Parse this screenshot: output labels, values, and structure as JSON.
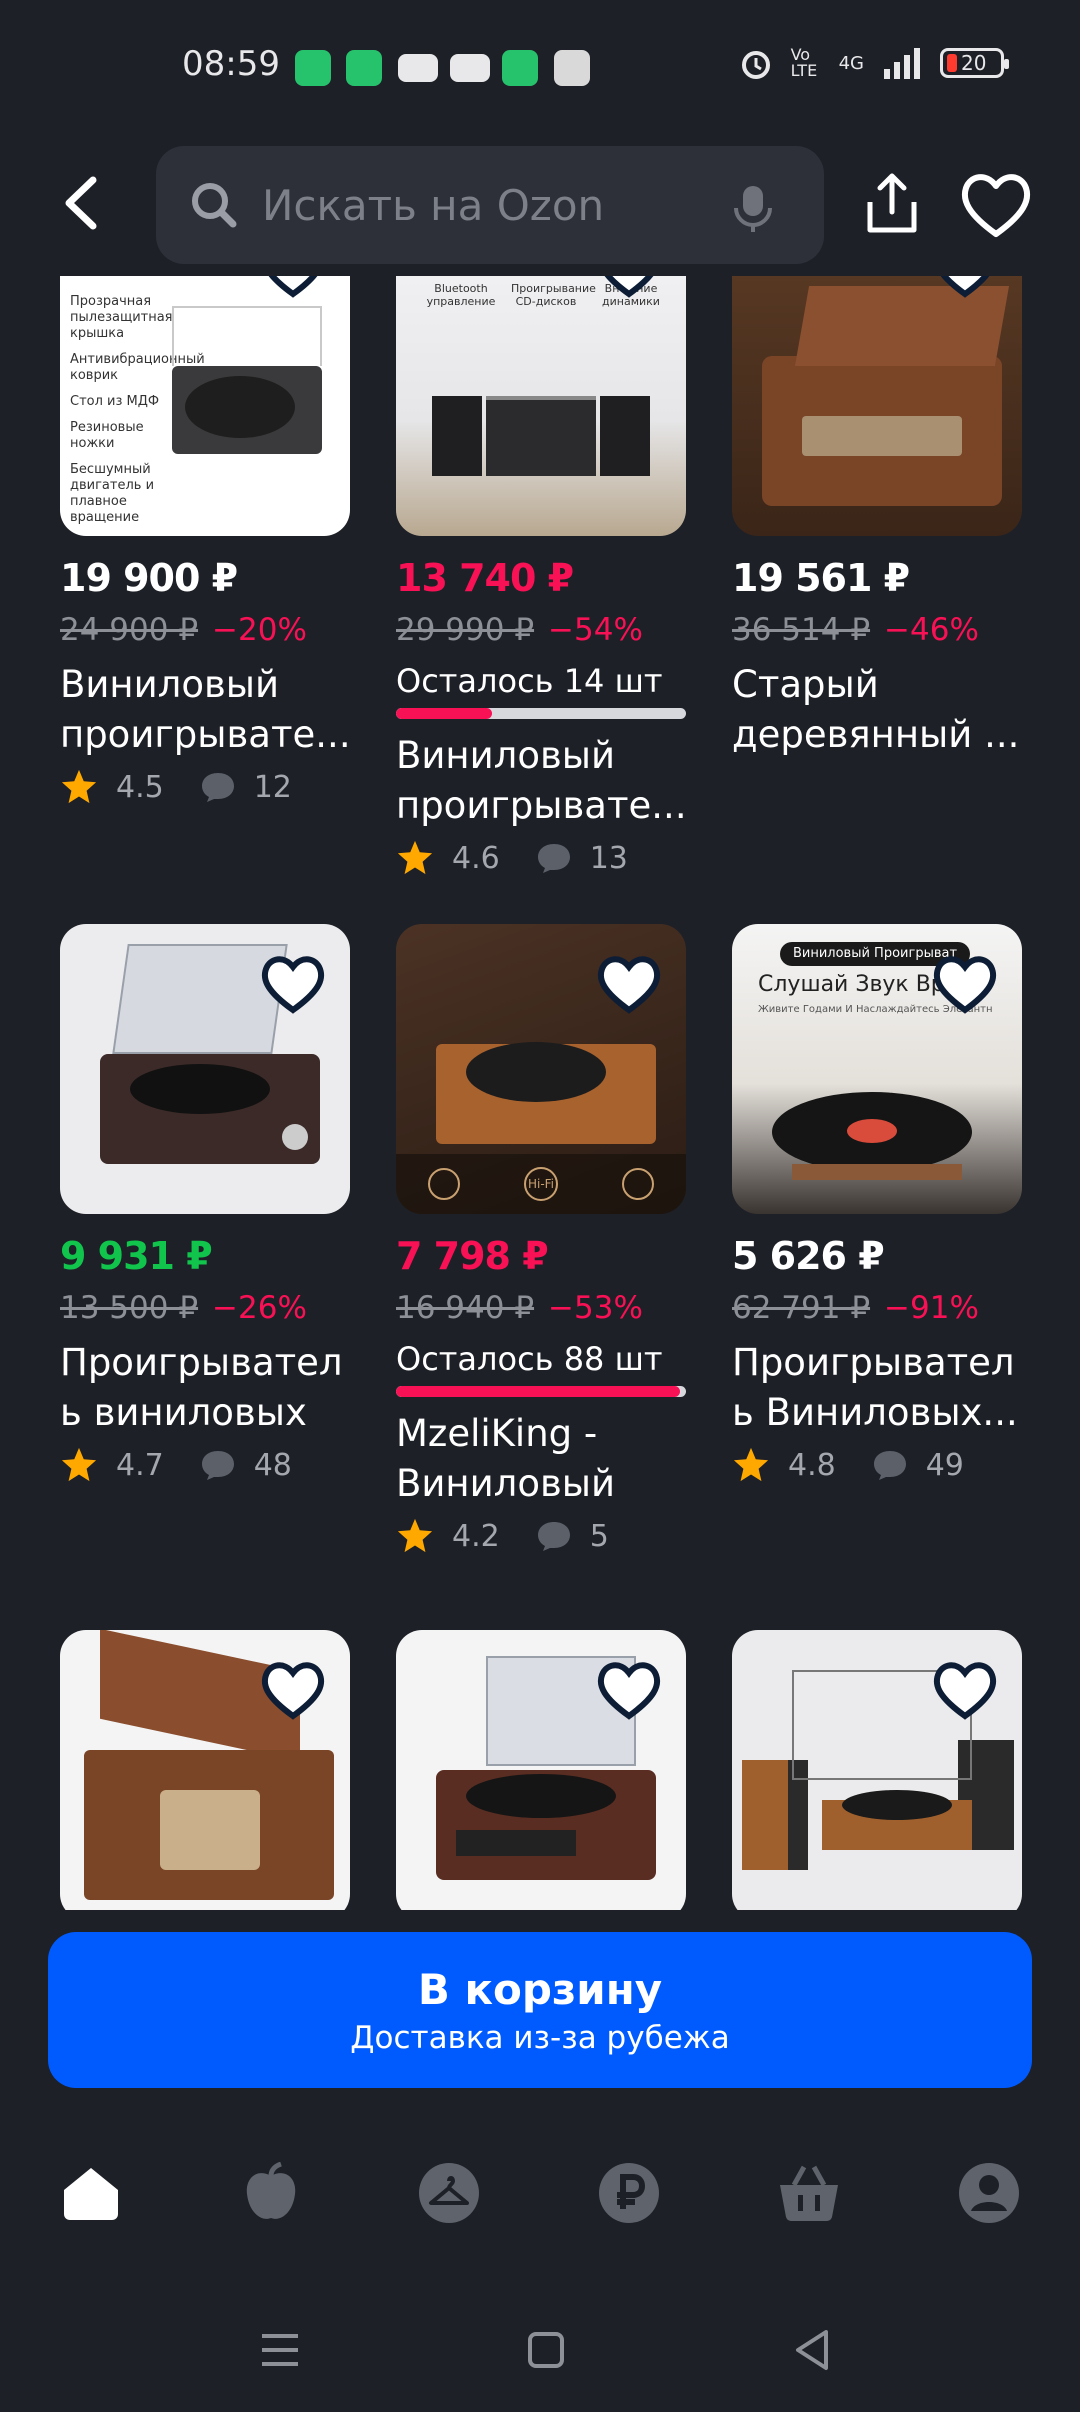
{
  "status_bar": {
    "time": "08:59",
    "network": "4G",
    "volte": "Vo LTE",
    "battery": "20"
  },
  "header": {
    "search_placeholder": "Искать на Ozon"
  },
  "products": [
    {
      "price": "19 900 ₽",
      "price_color": "white",
      "old_price": "24 900 ₽",
      "discount": "−20%",
      "stock": "",
      "stock_fraction": 0,
      "title": "Виниловый проигрывате...",
      "rating": "4.5",
      "reviews": "12"
    },
    {
      "price": "13 740 ₽",
      "price_color": "red",
      "old_price": "29 990 ₽",
      "discount": "−54%",
      "stock": "Осталось 14 шт",
      "stock_fraction": 0.33,
      "title": "Виниловый проигрывате...",
      "rating": "4.6",
      "reviews": "13"
    },
    {
      "price": "19 561 ₽",
      "price_color": "white",
      "old_price": "36 514 ₽",
      "discount": "−46%",
      "stock": "",
      "stock_fraction": 0,
      "title": "Старый деревянный ...",
      "rating": "",
      "reviews": ""
    },
    {
      "price": "9 931 ₽",
      "price_color": "green",
      "old_price": "13 500 ₽",
      "discount": "−26%",
      "stock": "",
      "stock_fraction": 0,
      "title": "Проигрывател ь виниловых ...",
      "rating": "4.7",
      "reviews": "48"
    },
    {
      "price": "7 798 ₽",
      "price_color": "red",
      "old_price": "16 940 ₽",
      "discount": "−53%",
      "stock": "Осталось 88 шт",
      "stock_fraction": 0.98,
      "title": "MzeliKing - Виниловый п...",
      "rating": "4.2",
      "reviews": "5"
    },
    {
      "price": "5 626 ₽",
      "price_color": "white",
      "old_price": "62 791 ₽",
      "discount": "−91%",
      "stock": "",
      "stock_fraction": 0,
      "title": "Проигрывател ь Виниловых...",
      "rating": "4.8",
      "reviews": "49"
    },
    {
      "price": "",
      "price_color": "white",
      "old_price": "",
      "discount": "",
      "stock": "",
      "stock_fraction": 0,
      "title": "",
      "rating": "",
      "reviews": ""
    },
    {
      "price": "",
      "price_color": "white",
      "old_price": "",
      "discount": "",
      "stock": "",
      "stock_fraction": 0,
      "title": "",
      "rating": "",
      "reviews": ""
    },
    {
      "price": "",
      "price_color": "white",
      "old_price": "",
      "discount": "",
      "stock": "",
      "stock_fraction": 0,
      "title": "",
      "rating": "",
      "reviews": ""
    }
  ],
  "image_texts": {
    "p1": [
      "Прозрачная пылезащитная крышка",
      "Антивибрационный коврик",
      "Стол из МДФ",
      "Резиновые ножки",
      "Бесшумный двигатель и плавное вращение"
    ],
    "p2": [
      "Bluetooth управление",
      "Проигрывание CD-дисков",
      "Внешние динамики"
    ],
    "p6": [
      "Виниловый Проигрыват",
      "Слушай Звук Вр",
      "Живите Годами И Наслаждайтесь Элегантн"
    ],
    "p5": [
      "Hi-Fi"
    ]
  },
  "cart": {
    "label": "В корзину",
    "sublabel": "Доставка из-за рубежа"
  },
  "colors": {
    "background": "#1d2027",
    "accent": "#005bff",
    "sale": "#f91155",
    "green_price": "#10c44c",
    "star": "#ffa800"
  },
  "nav_icons": [
    "home-icon",
    "fresh-icon",
    "hanger-icon",
    "ruble-icon",
    "basket-icon",
    "profile-icon"
  ]
}
